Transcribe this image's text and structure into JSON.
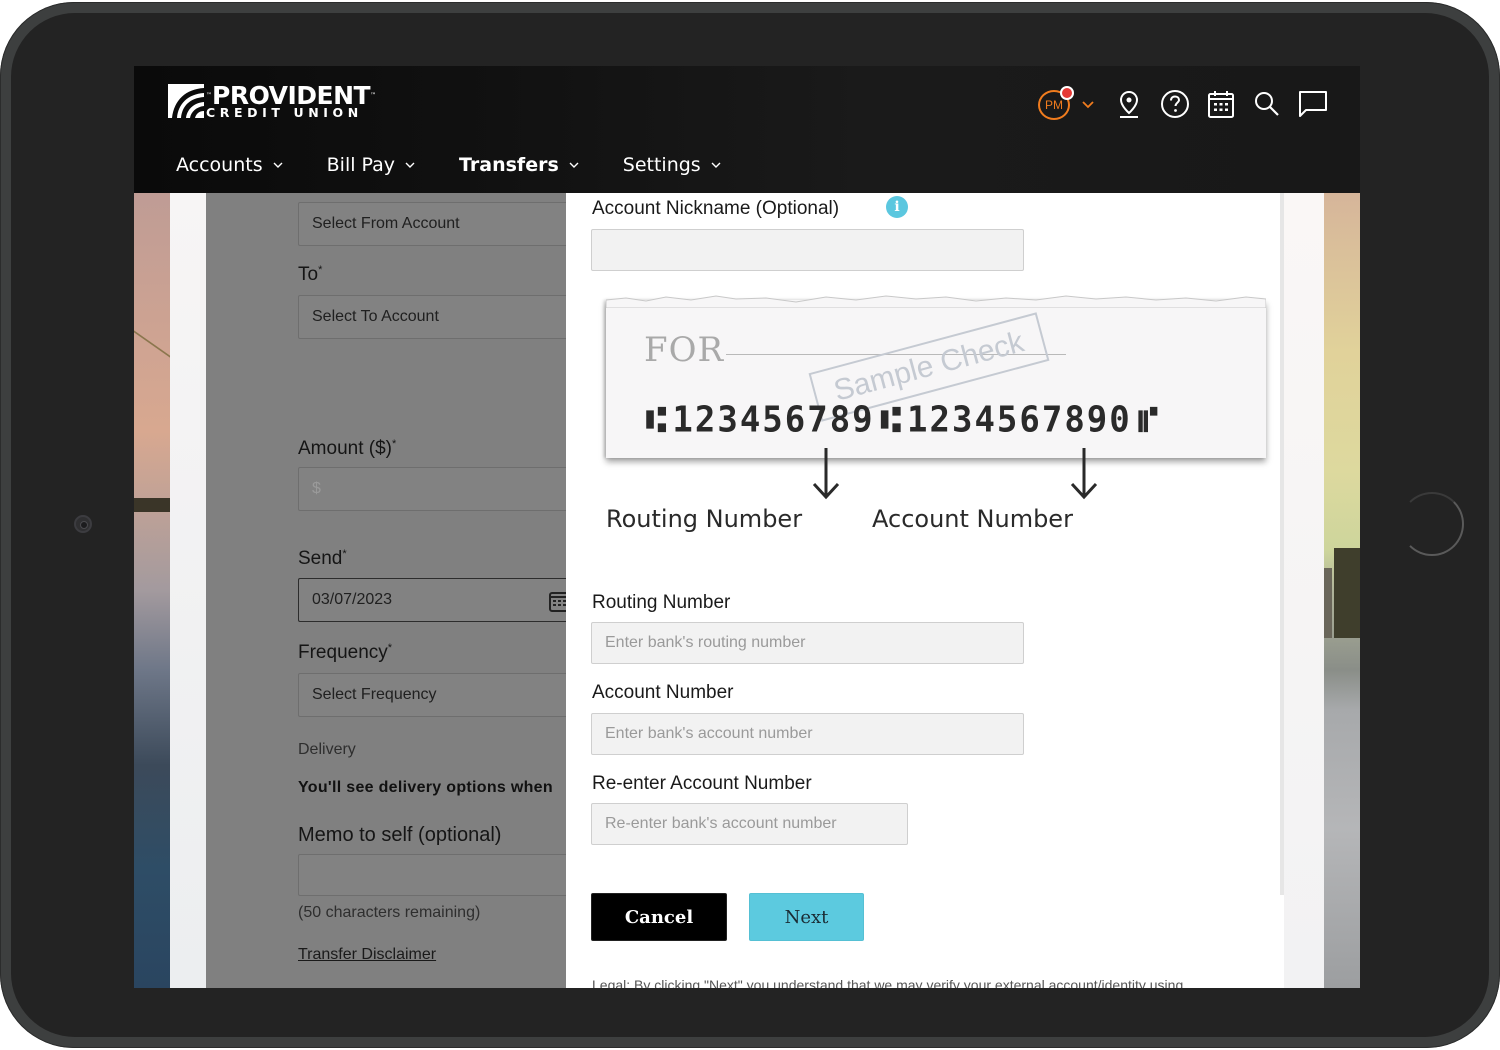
{
  "brand": {
    "name_line1": "PROVIDENT",
    "name_line2": "CREDIT UNION",
    "tm": "™",
    "colors": {
      "accent_orange": "#f07c1e",
      "notification_red": "#e53935",
      "next_button": "#5ccadf",
      "info_icon": "#5bc7df"
    }
  },
  "nav": {
    "items": [
      {
        "label": "Accounts",
        "active": false
      },
      {
        "label": "Bill Pay",
        "active": false
      },
      {
        "label": "Transfers",
        "active": true
      },
      {
        "label": "Settings",
        "active": false
      }
    ]
  },
  "header_icons": {
    "avatar_initials": "PM",
    "icons": [
      "location-pin-icon",
      "help-icon",
      "calendar-icon",
      "search-icon",
      "chat-icon"
    ]
  },
  "background_form": {
    "from_select": "Select From Account",
    "to_label": "To",
    "to_select": "Select To Account",
    "amount_label": "Amount ($)",
    "amount_placeholder": "$",
    "send_label": "Send",
    "send_date": "03/07/2023",
    "frequency_label": "Frequency",
    "frequency_select": "Select Frequency",
    "delivery_label": "Delivery",
    "delivery_note": "You'll see delivery options when",
    "memo_label": "Memo to self (optional)",
    "memo_value": "",
    "chars_remaining": "(50 characters remaining)",
    "disclaimer_link": "Transfer Disclaimer",
    "required_mark": "*"
  },
  "modal": {
    "nickname_label": "Account Nickname (Optional)",
    "nickname_value": "",
    "info_glyph": "i",
    "check": {
      "for_text": "FOR",
      "stamp_text": "Sample Check",
      "routing_digits": "123456789",
      "account_digits": "1234567890",
      "transit_symbol": "⑆",
      "on_us_symbol": "⑈",
      "routing_caption": "Routing Number",
      "account_caption": "Account Number"
    },
    "routing_label": "Routing Number",
    "routing_placeholder": "Enter bank's routing number",
    "account_label": "Account Number",
    "account_placeholder": "Enter bank's account number",
    "reenter_label": "Re-enter Account Number",
    "reenter_placeholder": "Re-enter bank's account number",
    "cancel_label": "Cancel",
    "next_label": "Next",
    "legal_text": "Legal: By clicking \"Next\" you understand that we may verify your external account/identity using"
  }
}
